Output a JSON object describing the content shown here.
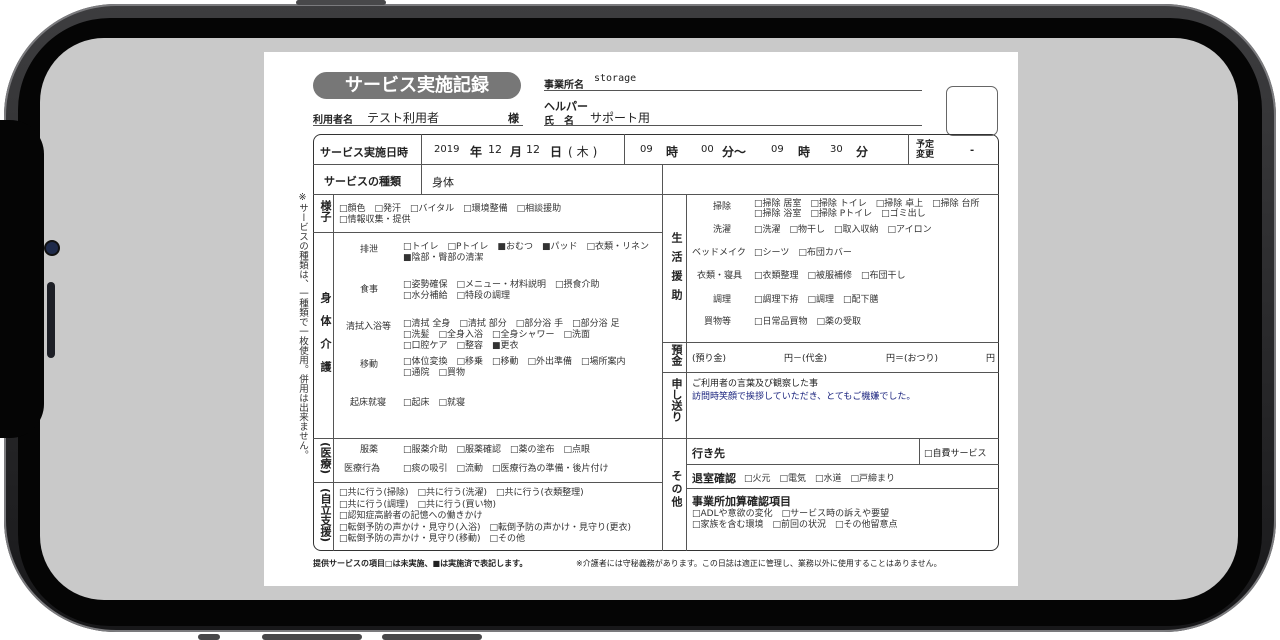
{
  "doc": {
    "title": "サービス実施記録",
    "office_label": "事業所名",
    "office_value": "storage",
    "user_label": "利用者名",
    "user_value": "テスト利用者",
    "user_suffix": "様",
    "helper_label": "ヘルパー",
    "helper_name_label": "氏　名",
    "helper_value": "サポート用",
    "side_note": "※サービスの種類は、一種類で一枚使用。併用は出来ません。",
    "date_label": "サービス実施日時",
    "year": "2019",
    "year_unit": "年",
    "month": "12",
    "month_unit": "月",
    "day": "12",
    "day_unit": "日",
    "weekday": "(木)",
    "start_hour": "09",
    "hour_unit": "時",
    "start_min": "00",
    "min_unit_tilde": "分～",
    "end_hour": "09",
    "end_min": "30",
    "min_unit": "分",
    "schedule_change_label": "予定変更",
    "schedule_change_value": "-",
    "service_type_label": "サービスの種類",
    "service_type_value": "身体",
    "yousu_label": "様子",
    "yousu_items": "□顔色　□発汗　□バイタル　□環境整備　□相談援助\n□情報収集・提供",
    "shintai_label": "身体介護",
    "haisetsu_label": "排泄",
    "haisetsu_items": "□トイレ　□Pトイレ　■おむつ　■パッド　□衣類・リネン\n■陰部・臀部の清潔",
    "shokuji_label": "食事",
    "shokuji_items": "□姿勢確保　□メニュー・材料説明　□摂食介助\n□水分補給　□特段の調理",
    "seishiki_label": "清拭入浴等",
    "seishiki_items": "□清拭 全身　□清拭 部分　□部分浴 手　□部分浴 足\n□洗髪　□全身入浴　□全身シャワー　□洗面\n□口腔ケア　□整容　■更衣",
    "ido_label": "移動",
    "ido_items": "□体位変換　□移乗　□移動　□外出準備　□場所案内\n□通院　□買物",
    "kisho_label": "起床就寝",
    "kisho_items": "□起床　□就寝",
    "iryo_label": "(医療)",
    "fukuyaku_label": "服薬",
    "fukuyaku_items": "□服薬介助　□服薬確認　□薬の塗布　□点眼",
    "iryokoi_label": "医療行為",
    "iryokoi_items": "□痰の吸引　□流動　□医療行為の準備・後片付け",
    "jiritsu_label": "(自立支援)",
    "jiritsu_items": "□共に行う(掃除)　□共に行う(洗濯)　□共に行う(衣類整理)\n□共に行う(調理)　□共に行う(買い物)\n□認知症高齢者の記憶への働きかけ\n□転倒予防の声かけ・見守り(入浴)　□転倒予防の声かけ・見守り(更衣)\n□転倒予防の声かけ・見守り(移動)　□その他",
    "seikatsu_label": "生活援助",
    "soji_label": "掃除",
    "soji_items": "□掃除 居室　□掃除 トイレ　□掃除 卓上　□掃除 台所\n□掃除 浴室　□掃除 Pトイレ　□ゴミ出し",
    "sentaku_label": "洗濯",
    "sentaku_items": "□洗濯　□物干し　□取入収納　□アイロン",
    "bed_label": "ベッドメイク",
    "bed_items": "□シーツ　□布団カバー",
    "irui_label": "衣類・寝具",
    "irui_items": "□衣類整理　□被服補修　□布団干し",
    "chori_label": "調理",
    "chori_items": "□調理下拵　□調理　□配下膳",
    "kaimono_label": "買物等",
    "kaimono_items": "□日常品買物　□薬の受取",
    "azukari_label": "預金",
    "azukari_text": "(預り金)",
    "azukari_mid": "円－(代金)",
    "azukari_end": "円＝(おつり)",
    "azukari_yen": "円",
    "moshiokuri_label": "申し送り",
    "moshiokuri_title": "ご利用者の言葉及び観察した事",
    "moshiokuri_text": "訪問時笑顔で挨拶していただき、とてもご機嫌でした。",
    "sonota_label": "その他",
    "ikisaki_label": "行き先",
    "jihi_label": "□自費サービス",
    "taishitsu_label": "退室確認",
    "taishitsu_items": "□火元　□電気　□水道　□戸締まり",
    "kasan_label": "事業所加算確認項目",
    "kasan_items": "□ADLや意欲の変化　□サービス時の訴えや要望\n□家族を含む環境　□前回の状況　□その他留意点",
    "footer_left": "提供サービスの項目□は未実施、■は実施済で表記します。",
    "footer_right": "※介護者には守秘義務があります。この日誌は適正に管理し、業務以外に使用することはありません。"
  }
}
